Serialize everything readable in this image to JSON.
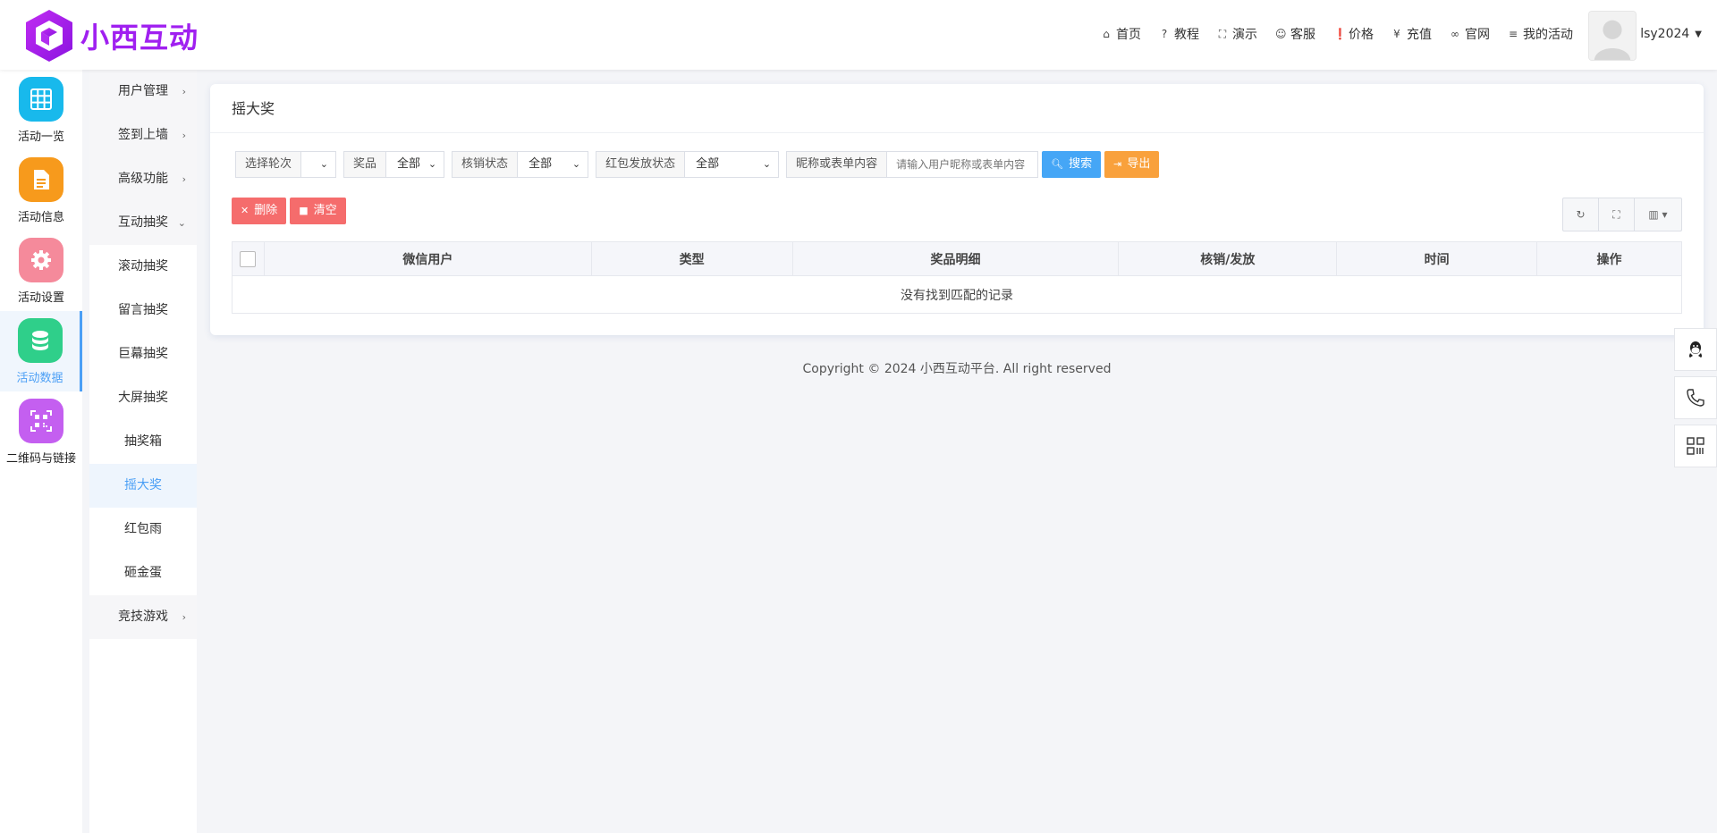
{
  "header": {
    "logo_text": "小西互动",
    "nav": [
      {
        "icon": "home-icon",
        "glyph": "⌂",
        "label": "首页"
      },
      {
        "icon": "help-icon",
        "glyph": "?",
        "label": "教程"
      },
      {
        "icon": "fullscreen-icon",
        "glyph": "⛶",
        "label": "演示"
      },
      {
        "icon": "smile-icon",
        "glyph": "☺",
        "label": "客服"
      },
      {
        "icon": "info-icon",
        "glyph": "❗",
        "label": "价格"
      },
      {
        "icon": "yen-icon",
        "glyph": "¥",
        "label": "充值"
      },
      {
        "icon": "link-icon",
        "glyph": "∞",
        "label": "官网"
      },
      {
        "icon": "list-icon",
        "glyph": "≡",
        "label": "我的活动"
      }
    ],
    "username": "lsy2024"
  },
  "rail": [
    {
      "label": "活动一览",
      "color": "#18b9ec",
      "icon": "grid-icon"
    },
    {
      "label": "活动信息",
      "color": "#f79a1c",
      "icon": "document-icon"
    },
    {
      "label": "活动设置",
      "color": "#f58a9b",
      "icon": "gear-icon"
    },
    {
      "label": "活动数据",
      "color": "#2fcf8a",
      "icon": "database-icon",
      "active": true
    },
    {
      "label": "二维码与链接",
      "color": "#c45ff0",
      "icon": "qrcode-icon"
    }
  ],
  "subnav": [
    {
      "label": "用户管理",
      "arrow": "›",
      "group": true
    },
    {
      "label": "签到上墙",
      "arrow": "›",
      "group": true
    },
    {
      "label": "高级功能",
      "arrow": "›",
      "group": true
    },
    {
      "label": "互动抽奖",
      "arrow": "⌄",
      "group": true
    },
    {
      "label": "滚动抽奖"
    },
    {
      "label": "留言抽奖"
    },
    {
      "label": "巨幕抽奖"
    },
    {
      "label": "大屏抽奖"
    },
    {
      "label": "抽奖箱"
    },
    {
      "label": "摇大奖",
      "active": true
    },
    {
      "label": "红包雨"
    },
    {
      "label": "砸金蛋"
    },
    {
      "label": "竞技游戏",
      "arrow": "›",
      "group": true
    }
  ],
  "card": {
    "title": "摇大奖",
    "filters": {
      "round_label": "选择轮次",
      "round_value": "",
      "prize_label": "奖品",
      "prize_value": "全部",
      "verify_label": "核销状态",
      "verify_value": "全部",
      "redpack_label": "红包发放状态",
      "redpack_value": "全部",
      "keyword_label": "昵称或表单内容",
      "keyword_placeholder": "请输入用户昵称或表单内容",
      "search_label": "搜索",
      "export_label": "导出"
    },
    "actions": {
      "delete_label": "删除",
      "clear_label": "清空"
    },
    "table": {
      "columns": [
        "微信用户",
        "类型",
        "奖品明细",
        "核销/发放",
        "时间",
        "操作"
      ],
      "empty_text": "没有找到匹配的记录"
    }
  },
  "footer": {
    "copyright": "Copyright © 2024 小西互动平台. All right reserved"
  }
}
